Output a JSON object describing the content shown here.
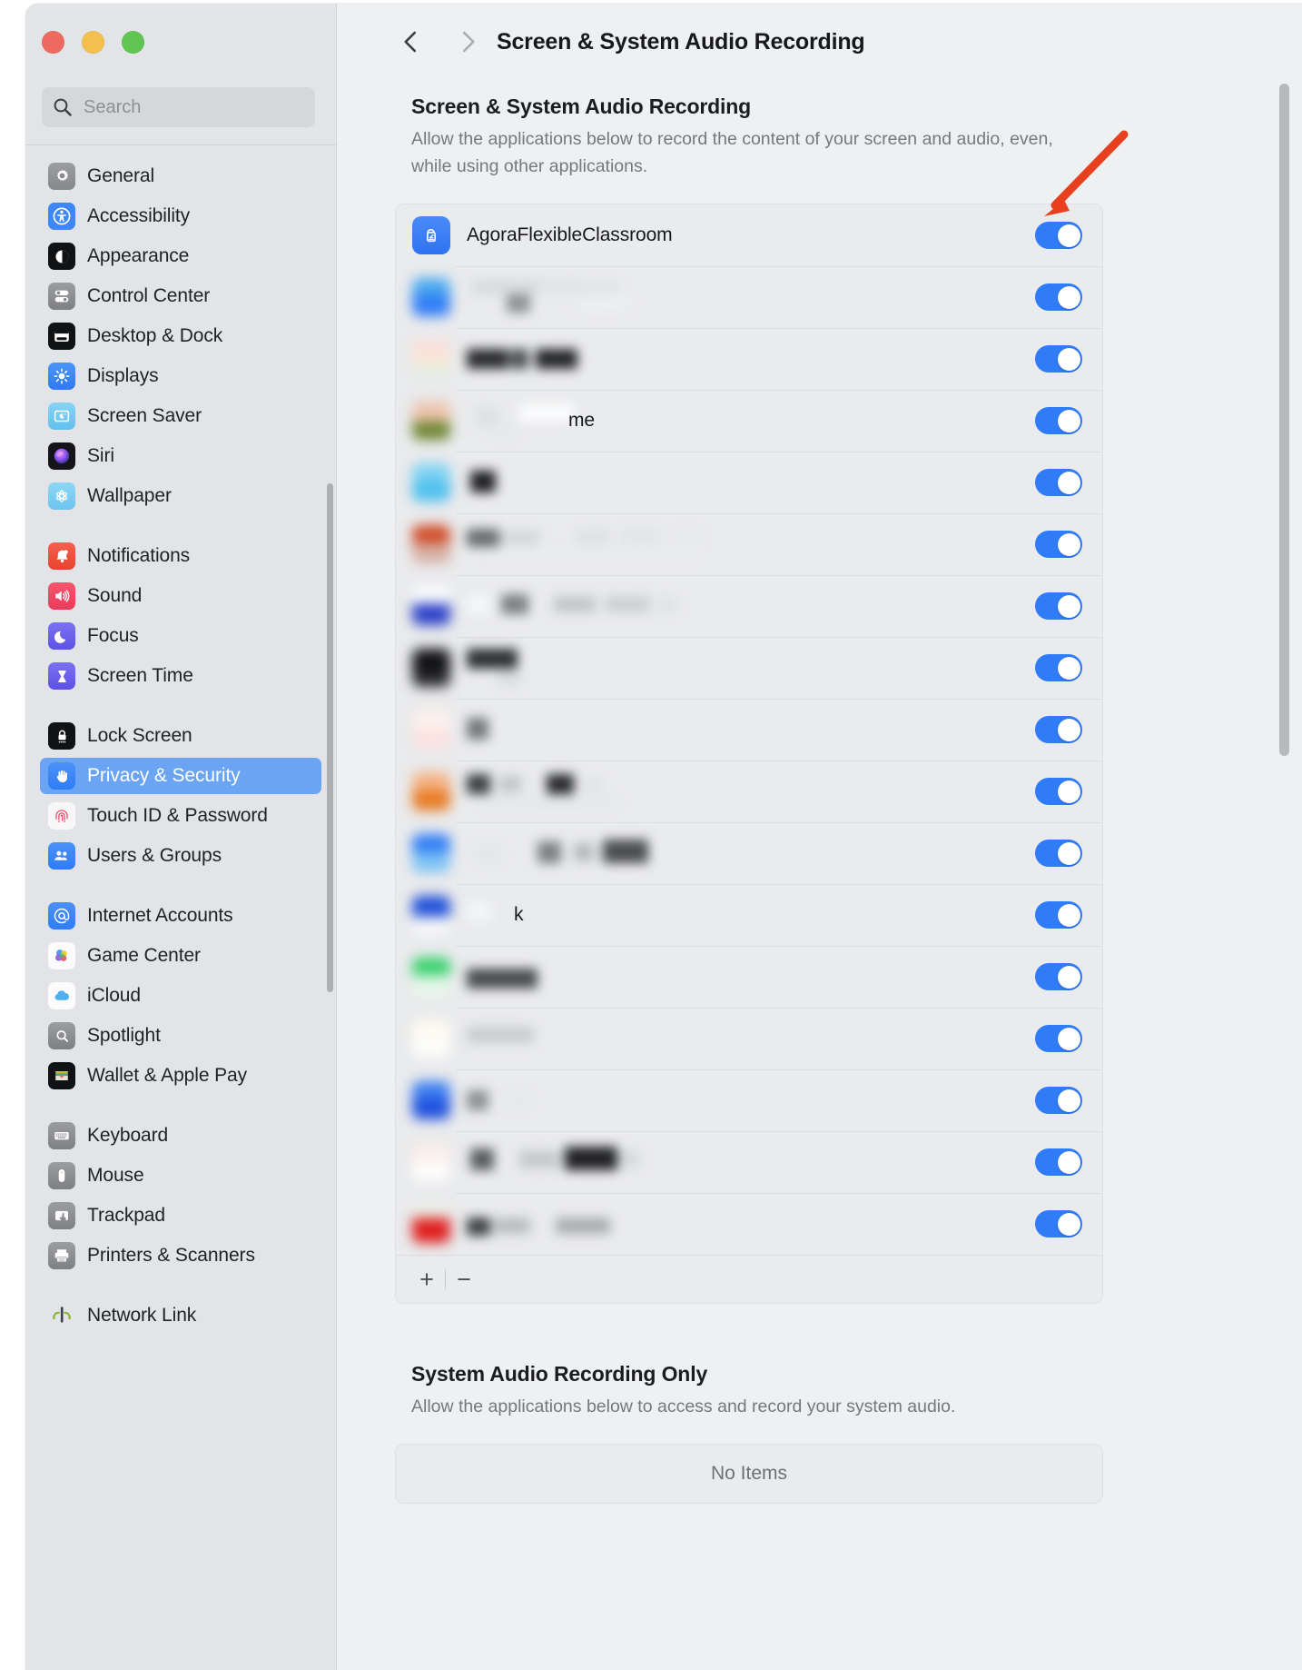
{
  "window": {
    "traffic_lights": [
      "close",
      "minimize",
      "zoom"
    ],
    "colors": {
      "close": "#ec6a5f",
      "minimize": "#f3bf4f",
      "zoom": "#61c554"
    }
  },
  "search": {
    "placeholder": "Search",
    "value": "",
    "icon": "search-icon"
  },
  "sidebar": {
    "groups": [
      {
        "items": [
          {
            "label": "General",
            "icon": "gear-icon",
            "selected": false
          },
          {
            "label": "Accessibility",
            "icon": "accessibility-icon",
            "selected": false
          },
          {
            "label": "Appearance",
            "icon": "appearance-icon",
            "selected": false
          },
          {
            "label": "Control Center",
            "icon": "control-center-icon",
            "selected": false
          },
          {
            "label": "Desktop & Dock",
            "icon": "desktop-dock-icon",
            "selected": false
          },
          {
            "label": "Displays",
            "icon": "displays-icon",
            "selected": false
          },
          {
            "label": "Screen Saver",
            "icon": "screen-saver-icon",
            "selected": false
          },
          {
            "label": "Siri",
            "icon": "siri-icon",
            "selected": false
          },
          {
            "label": "Wallpaper",
            "icon": "wallpaper-icon",
            "selected": false
          }
        ]
      },
      {
        "items": [
          {
            "label": "Notifications",
            "icon": "bell-icon",
            "selected": false
          },
          {
            "label": "Sound",
            "icon": "speaker-icon",
            "selected": false
          },
          {
            "label": "Focus",
            "icon": "moon-icon",
            "selected": false
          },
          {
            "label": "Screen Time",
            "icon": "hourglass-icon",
            "selected": false
          }
        ]
      },
      {
        "items": [
          {
            "label": "Lock Screen",
            "icon": "lock-icon",
            "selected": false
          },
          {
            "label": "Privacy & Security",
            "icon": "hand-icon",
            "selected": true
          },
          {
            "label": "Touch ID & Password",
            "icon": "fingerprint-icon",
            "selected": false
          },
          {
            "label": "Users & Groups",
            "icon": "users-icon",
            "selected": false
          }
        ]
      },
      {
        "items": [
          {
            "label": "Internet Accounts",
            "icon": "at-sign-icon",
            "selected": false
          },
          {
            "label": "Game Center",
            "icon": "game-center-icon",
            "selected": false
          },
          {
            "label": "iCloud",
            "icon": "cloud-icon",
            "selected": false
          },
          {
            "label": "Spotlight",
            "icon": "magnifier-icon",
            "selected": false
          },
          {
            "label": "Wallet & Apple Pay",
            "icon": "wallet-icon",
            "selected": false
          }
        ]
      },
      {
        "items": [
          {
            "label": "Keyboard",
            "icon": "keyboard-icon",
            "selected": false
          },
          {
            "label": "Mouse",
            "icon": "mouse-icon",
            "selected": false
          },
          {
            "label": "Trackpad",
            "icon": "trackpad-icon",
            "selected": false
          },
          {
            "label": "Printers & Scanners",
            "icon": "printer-icon",
            "selected": false
          }
        ]
      },
      {
        "items": [
          {
            "label": "Network Link",
            "icon": "network-link-conditioner-icon",
            "selected": false
          }
        ]
      }
    ]
  },
  "toolbar": {
    "back_icon": "chevron-left-icon",
    "forward_icon": "chevron-right-icon",
    "title": "Screen & System Audio Recording"
  },
  "main": {
    "screen_recording": {
      "heading": "Screen & System Audio Recording",
      "description": "Allow the applications below to record the content of your screen and audio, even, while using other applications.",
      "apps": [
        {
          "name": "AgoraFlexibleClassroom",
          "enabled": true,
          "redacted": false,
          "icon_color": "#3d7ff0"
        },
        {
          "name": "",
          "enabled": true,
          "redacted": true,
          "icon_color": "#2f85f0"
        },
        {
          "name": "",
          "enabled": true,
          "redacted": true,
          "icon_color": "#f7d8cf"
        },
        {
          "name": "me",
          "enabled": true,
          "redacted": true,
          "icon_color": "#e8bca8"
        },
        {
          "name": "",
          "enabled": true,
          "redacted": true,
          "icon_color": "#62c6ef"
        },
        {
          "name": "",
          "enabled": true,
          "redacted": true,
          "icon_color": "#d04a26"
        },
        {
          "name": "",
          "enabled": true,
          "redacted": true,
          "icon_color": "#2b40c8"
        },
        {
          "name": "",
          "enabled": true,
          "redacted": true,
          "icon_color": "#151515"
        },
        {
          "name": "",
          "enabled": true,
          "redacted": true,
          "icon_color": "#fbe3e0"
        },
        {
          "name": "",
          "enabled": true,
          "redacted": true,
          "icon_color": "#f08a3c"
        },
        {
          "name": "",
          "enabled": true,
          "redacted": true,
          "icon_color": "#2f7cf6"
        },
        {
          "name": "k",
          "enabled": true,
          "redacted": true,
          "icon_color": "#1f4fd8"
        },
        {
          "name": "",
          "enabled": true,
          "redacted": true,
          "icon_color": "#35d06a"
        },
        {
          "name": "",
          "enabled": true,
          "redacted": true,
          "icon_color": "#fdf6e3"
        },
        {
          "name": "",
          "enabled": true,
          "redacted": true,
          "icon_color": "#2064e8"
        },
        {
          "name": "",
          "enabled": true,
          "redacted": true,
          "icon_color": "#f5d7cc"
        },
        {
          "name": "",
          "enabled": true,
          "redacted": true,
          "icon_color": "#e02020"
        }
      ],
      "add_label": "+",
      "remove_label": "−"
    },
    "system_audio_only": {
      "heading": "System Audio Recording Only",
      "description": "Allow the applications below to access and record your system audio.",
      "empty_label": "No Items"
    }
  },
  "annotation": {
    "arrow_color": "#e8401f",
    "points_to": "first-app-toggle"
  }
}
